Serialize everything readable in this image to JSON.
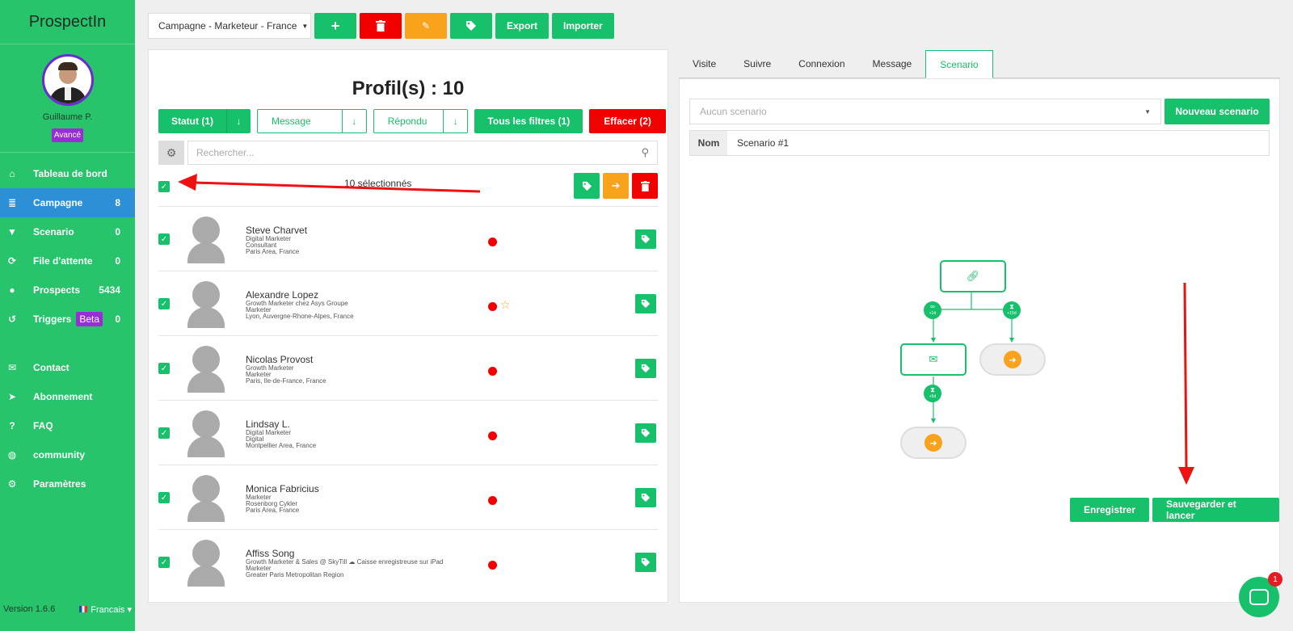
{
  "sidebar": {
    "brand": "ProspectIn",
    "user": "Guillaume P.",
    "plan_badge": "Avancé",
    "nav": [
      {
        "icon": "home-icon",
        "glyph": "⌂",
        "label": "Tableau de bord",
        "count": ""
      },
      {
        "icon": "list-icon",
        "glyph": "≣",
        "label": "Campagne",
        "count": "8",
        "active": true
      },
      {
        "icon": "filter-icon",
        "glyph": "▼",
        "label": "Scenario",
        "count": "0"
      },
      {
        "icon": "refresh-icon",
        "glyph": "⟳",
        "label": "File d'attente",
        "count": "0"
      },
      {
        "icon": "user-icon",
        "glyph": "●",
        "label": "Prospects",
        "count": "5434"
      },
      {
        "icon": "history-icon",
        "glyph": "↺",
        "label": "Triggers",
        "badge": "Beta",
        "count": "0"
      }
    ],
    "nav2": [
      {
        "icon": "envelope-icon",
        "glyph": "✉",
        "label": "Contact"
      },
      {
        "icon": "rocket-icon",
        "glyph": "➤",
        "label": "Abonnement"
      },
      {
        "icon": "question-icon",
        "glyph": "?",
        "label": "FAQ"
      },
      {
        "icon": "discord-icon",
        "glyph": "◍",
        "label": "community"
      },
      {
        "icon": "gear-icon",
        "glyph": "⚙",
        "label": "Paramètres"
      }
    ],
    "version": "Version 1.6.6",
    "language": "Francais"
  },
  "toolbar": {
    "campaign": "Campagne - Marketeur - France",
    "export_label": "Export",
    "import_label": "Importer"
  },
  "left": {
    "title": "Profil(s) : 10",
    "filters": {
      "statut": "Statut (1)",
      "message": "Message",
      "repondu": "Répondu",
      "all_filters": "Tous les filtres (1)",
      "clear": "Effacer (2)"
    },
    "search_placeholder": "Rechercher...",
    "selected_text": "10 sélectionnés",
    "profiles": [
      {
        "name": "Steve Charvet",
        "lines": [
          "Digital Marketer",
          "Consultant",
          "Paris Area, France"
        ],
        "star": false
      },
      {
        "name": "Alexandre Lopez",
        "lines": [
          "Growth Marketer chez Asys Groupe",
          "Marketer",
          "Lyon, Auvergne-Rhone-Alpes, France"
        ],
        "star": true
      },
      {
        "name": "Nicolas Provost",
        "lines": [
          "Growth Marketer",
          "Marketer",
          "Paris, Ile-de-France, France"
        ],
        "star": false
      },
      {
        "name": "Lindsay L.",
        "lines": [
          "Digital Marketer",
          "Digital",
          "Montpellier Area, France"
        ],
        "star": false
      },
      {
        "name": "Monica Fabricius",
        "lines": [
          "Marketer",
          "Rosenborg Cykler",
          "Paris Area, France"
        ],
        "star": false
      },
      {
        "name": "Affiss Song",
        "lines": [
          "Growth Marketer & Sales @ SkyTill ☁ Caisse enregistreuse sur iPad",
          "Marketer",
          "Greater Paris Metropolitan Region"
        ],
        "star": false
      }
    ]
  },
  "right": {
    "tabs": [
      "Visite",
      "Suivre",
      "Connexion",
      "Message",
      "Scenario"
    ],
    "active_tab": "Scenario",
    "scenario_placeholder": "Aucun scenario",
    "new_scenario": "Nouveau scenario",
    "name_label": "Nom",
    "name_value": "Scenario #1",
    "flow_delays": {
      "a": "+1d",
      "b": "+15d",
      "c": "+5d"
    },
    "save_label": "Enregistrer",
    "save_launch_label": "Sauvegarder et lancer"
  },
  "chat": {
    "notifications": "1"
  },
  "colors": {
    "accent": "#17c06a",
    "danger": "#f20000",
    "warning": "#f9a21b",
    "active_nav": "#2d8fd6",
    "badge": "#9b2bd6"
  }
}
